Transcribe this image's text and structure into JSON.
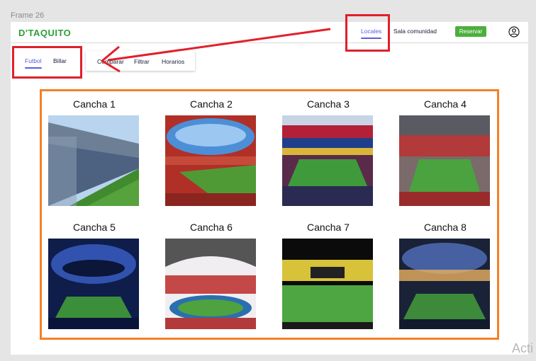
{
  "frame_label": "Frame 26",
  "header": {
    "logo": "D'TAQUITO",
    "nav": [
      {
        "label": "Locales",
        "active": true
      },
      {
        "label": "Sala comunidad",
        "active": false
      }
    ],
    "reserve_button": "Reservar",
    "user_icon": "user-circle-icon"
  },
  "tabs": [
    {
      "label": "Futbol",
      "active": true
    },
    {
      "label": "Billar",
      "active": false
    }
  ],
  "toolbar": {
    "items": [
      "Comparar",
      "Filtrar",
      "Horarios"
    ]
  },
  "courts": [
    {
      "name": "Cancha 1"
    },
    {
      "name": "Cancha 2"
    },
    {
      "name": "Cancha 3"
    },
    {
      "name": "Cancha 4"
    },
    {
      "name": "Cancha 5"
    },
    {
      "name": "Cancha 6"
    },
    {
      "name": "Cancha 7"
    },
    {
      "name": "Cancha 8"
    }
  ],
  "watermark": "Acti",
  "colors": {
    "brand_green": "#2e9e3a",
    "button_green": "#4caf3c",
    "accent_purple": "#5b5ce6",
    "annotation_red": "#e0202a",
    "highlight_orange": "#f58025"
  }
}
